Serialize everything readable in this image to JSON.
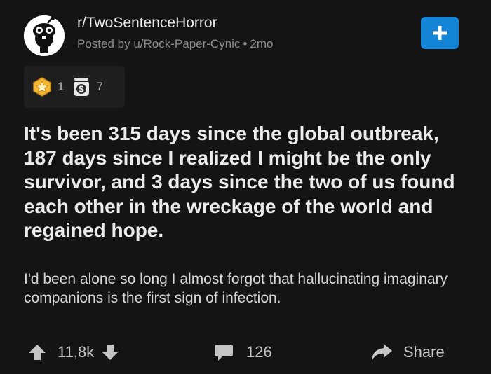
{
  "header": {
    "subreddit": "r/TwoSentenceHorror",
    "posted_by": "Posted by u/Rock-Paper-Cynic",
    "separator": "•",
    "age": "2mo",
    "avatar_icon": "snoo-avatar-icon",
    "join_icon": "plus-icon",
    "join_color": "#1484d6"
  },
  "awards": [
    {
      "icon": "gold-award-icon",
      "count": "1"
    },
    {
      "icon": "silver-award-icon",
      "count": "7"
    }
  ],
  "post": {
    "title": "It's been 315 days since the global outbreak, 187 days since I realized I might be the only survivor, and 3 days since the two of us found each other in the wreckage of the world and regained hope.",
    "body": "I'd been alone so long I almost forgot that hallucinating imaginary companions is the first sign of infection."
  },
  "actions": {
    "votes": "11,8k",
    "comments": "126",
    "share": "Share"
  },
  "colors": {
    "background": "#141414",
    "accent": "#1484d6"
  }
}
